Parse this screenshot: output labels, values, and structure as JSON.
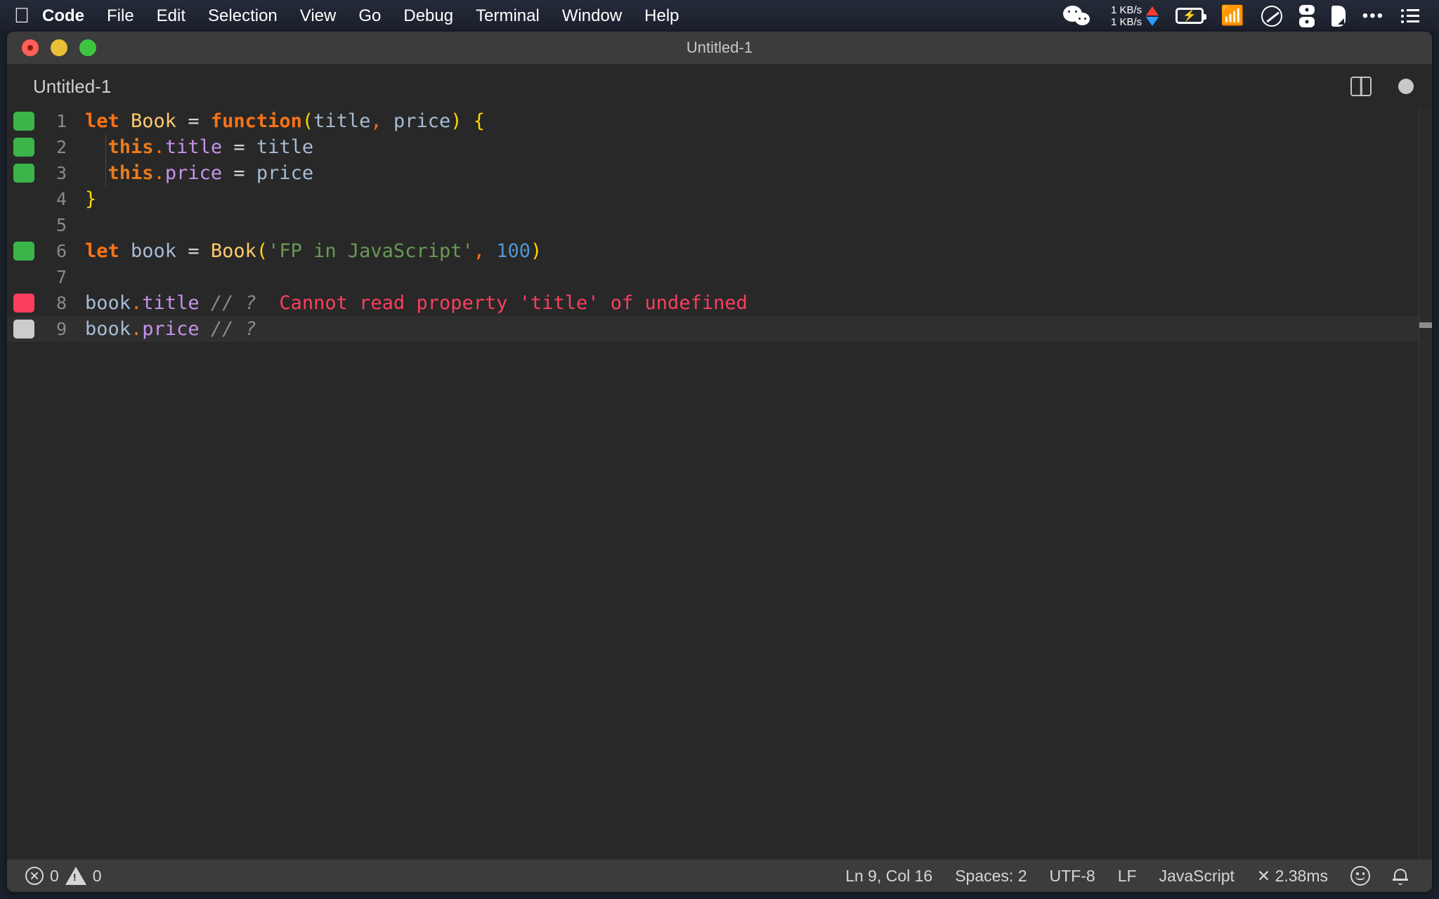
{
  "menubar": {
    "apple_icon": "apple-logo-icon",
    "items": [
      {
        "label": "Code",
        "bold": true
      },
      {
        "label": "File",
        "bold": false
      },
      {
        "label": "Edit",
        "bold": false
      },
      {
        "label": "Selection",
        "bold": false
      },
      {
        "label": "View",
        "bold": false
      },
      {
        "label": "Go",
        "bold": false
      },
      {
        "label": "Debug",
        "bold": false
      },
      {
        "label": "Terminal",
        "bold": false
      },
      {
        "label": "Window",
        "bold": false
      },
      {
        "label": "Help",
        "bold": false
      }
    ],
    "tray": {
      "wechat_icon": "wechat-icon",
      "network_up": "1 KB/s",
      "network_down": "1 KB/s",
      "battery_icon": "battery-charging-icon",
      "wifi_icon": "wifi-icon",
      "dnd_icon": "do-not-disturb-icon",
      "stack_icon": "stack-icon",
      "shield_icon": "shield-icon",
      "more_icon": "ellipsis-icon",
      "controlcenter_icon": "list-icon"
    },
    "colors": {
      "bar_bg": "#1b202c",
      "up_arrow": "#ff3b30",
      "down_arrow": "#2f9bff"
    }
  },
  "window": {
    "title": "Untitled-1",
    "traffic_lights": {
      "close": "close-button",
      "minimize": "minimize-button",
      "maximize": "maximize-button"
    }
  },
  "tabbar": {
    "tabs": [
      {
        "label": "Untitled-1",
        "active": true,
        "dirty": true
      }
    ],
    "split_editor_label": "split-editor-icon",
    "dirty_indicator_label": "unsaved-dot-icon"
  },
  "editor": {
    "lines": [
      {
        "number": "1",
        "marker": "green",
        "active": false,
        "indent_guide": false,
        "tokens": [
          {
            "text": "let ",
            "cls": "t-key"
          },
          {
            "text": "Book ",
            "cls": "t-fn"
          },
          {
            "text": "= ",
            "cls": "t-op"
          },
          {
            "text": "function",
            "cls": "t-key"
          },
          {
            "text": "(",
            "cls": "t-brack"
          },
          {
            "text": "title",
            "cls": "t-var"
          },
          {
            "text": ",",
            "cls": "t-punc"
          },
          {
            "text": " price",
            "cls": "t-var"
          },
          {
            "text": ")",
            "cls": "t-brack"
          },
          {
            "text": " ",
            "cls": "t-op"
          },
          {
            "text": "{",
            "cls": "t-brack"
          }
        ]
      },
      {
        "number": "2",
        "marker": "green",
        "active": false,
        "indent_guide": true,
        "tokens": [
          {
            "text": "  ",
            "cls": "t-op"
          },
          {
            "text": "this",
            "cls": "t-this"
          },
          {
            "text": ".",
            "cls": "t-punc"
          },
          {
            "text": "title",
            "cls": "t-prop"
          },
          {
            "text": " = ",
            "cls": "t-op"
          },
          {
            "text": "title",
            "cls": "t-var"
          }
        ]
      },
      {
        "number": "3",
        "marker": "green",
        "active": false,
        "indent_guide": true,
        "tokens": [
          {
            "text": "  ",
            "cls": "t-op"
          },
          {
            "text": "this",
            "cls": "t-this"
          },
          {
            "text": ".",
            "cls": "t-punc"
          },
          {
            "text": "price",
            "cls": "t-prop"
          },
          {
            "text": " = ",
            "cls": "t-op"
          },
          {
            "text": "price",
            "cls": "t-var"
          }
        ]
      },
      {
        "number": "4",
        "marker": "none",
        "active": false,
        "indent_guide": false,
        "tokens": [
          {
            "text": "}",
            "cls": "t-brack"
          }
        ]
      },
      {
        "number": "5",
        "marker": "none",
        "active": false,
        "indent_guide": false,
        "tokens": []
      },
      {
        "number": "6",
        "marker": "green",
        "active": false,
        "indent_guide": false,
        "tokens": [
          {
            "text": "let ",
            "cls": "t-key"
          },
          {
            "text": "book ",
            "cls": "t-var"
          },
          {
            "text": "= ",
            "cls": "t-op"
          },
          {
            "text": "Book",
            "cls": "t-fn"
          },
          {
            "text": "(",
            "cls": "t-brack"
          },
          {
            "text": "'FP in JavaScript'",
            "cls": "t-str"
          },
          {
            "text": ",",
            "cls": "t-punc"
          },
          {
            "text": " 100",
            "cls": "t-num"
          },
          {
            "text": ")",
            "cls": "t-brack"
          }
        ]
      },
      {
        "number": "7",
        "marker": "none",
        "active": false,
        "indent_guide": false,
        "tokens": []
      },
      {
        "number": "8",
        "marker": "red",
        "active": false,
        "indent_guide": false,
        "tokens": [
          {
            "text": "book",
            "cls": "t-var"
          },
          {
            "text": ".",
            "cls": "t-punc"
          },
          {
            "text": "title",
            "cls": "t-prop"
          },
          {
            "text": " // ?  ",
            "cls": "t-cmt"
          },
          {
            "text": "Cannot read property 'title' of undefined",
            "cls": "t-err"
          }
        ]
      },
      {
        "number": "9",
        "marker": "grey",
        "active": true,
        "indent_guide": false,
        "tokens": [
          {
            "text": "book",
            "cls": "t-var"
          },
          {
            "text": ".",
            "cls": "t-punc"
          },
          {
            "text": "price",
            "cls": "t-prop"
          },
          {
            "text": " // ?",
            "cls": "t-cmt"
          }
        ]
      }
    ],
    "marker_colors": {
      "green": "#3bb54a",
      "red": "#fb3e5e",
      "grey": "#cccccc"
    },
    "scrollbar_label": "vertical-scrollbar"
  },
  "statusbar": {
    "errors_icon": "error-circle-icon",
    "errors_count": "0",
    "warnings_icon": "warning-triangle-icon",
    "warnings_count": "0",
    "cursor_position": "Ln 9, Col 16",
    "indentation": "Spaces: 2",
    "encoding": "UTF-8",
    "eol": "LF",
    "language": "JavaScript",
    "quokka_time": "✕ 2.38ms",
    "feedback_icon": "smiley-icon",
    "notifications_icon": "bell-icon"
  }
}
